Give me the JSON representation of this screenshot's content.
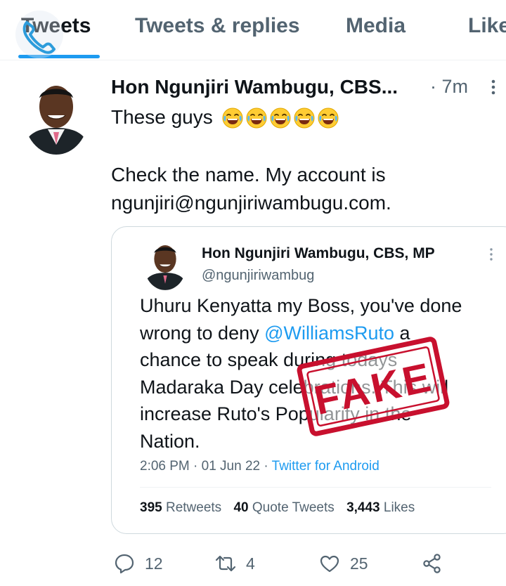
{
  "tabs": [
    {
      "label": "Tweets",
      "active": true
    },
    {
      "label": "Tweets & replies",
      "active": false
    },
    {
      "label": "Media",
      "active": false
    },
    {
      "label": "Like",
      "active": false
    }
  ],
  "tweet": {
    "author": "Hon Ngunjiri Wambugu, CBS...",
    "time": "· 7m",
    "text_line1": "These guys",
    "emoji_count": 5,
    "text_line2": "Check the name. My account is",
    "text_line3": "ngunjiri@ngunjiriwambugu.com."
  },
  "quoted": {
    "name": "Hon Ngunjiri Wambugu, CBS, MP",
    "handle": "@ngunjiriwambug",
    "text_line1": "Uhuru Kenyatta my Boss, you've done",
    "text_line2_pre": "wrong to deny ",
    "text_line2_mention": "@WilliamsRuto",
    "text_line2_post": " a",
    "text_line3": "chance to speak during todays",
    "text_line4": "Madaraka Day celebrations. This will",
    "text_line5": "increase Ruto's Popularity in the",
    "text_line6": "Nation.",
    "meta_time": "2:06 PM · 01 Jun 22 · ",
    "meta_source": "Twitter for Android",
    "retweets_count": "395",
    "retweets_label": "Retweets",
    "quotes_count": "40",
    "quotes_label": "Quote Tweets",
    "likes_count": "3,443",
    "likes_label": "Likes",
    "stamp_text": "FAKE"
  },
  "actions": {
    "replies": "12",
    "retweets": "4",
    "likes": "25"
  },
  "colors": {
    "accent": "#1d9bf0",
    "stamp": "#c8102e",
    "muted": "#536471"
  }
}
